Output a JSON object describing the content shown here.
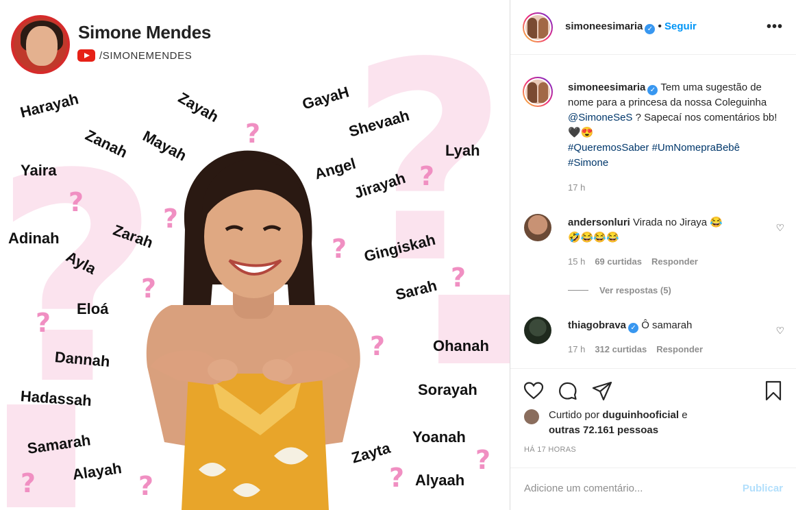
{
  "post_image": {
    "brand_title": "Simone Mendes",
    "youtube_handle": "/SIMONEMENDES",
    "names": [
      "Harayah",
      "Zayah",
      "GayaH",
      "Zanah",
      "Mayah",
      "Shevaah",
      "Yaira",
      "Lyah",
      "Angel",
      "Jirayah",
      "Zarah",
      "Adinah",
      "Ayla",
      "Gingiskah",
      "Sarah",
      "Eloá",
      "Ohanah",
      "Dannah",
      "Sorayah",
      "Hadassah",
      "Yoanah",
      "Samarah",
      "Zayta",
      "Alayah",
      "Alyaah"
    ],
    "question_mark": "?"
  },
  "header": {
    "username": "simoneesimaria",
    "verified_glyph": "✓",
    "dot": "•",
    "follow_label": "Seguir",
    "more_glyph": "•••"
  },
  "caption": {
    "username": "simoneesimaria",
    "text_before_mention": "Tem uma sugestão de nome para a princesa da nossa Coleguinha",
    "mention": "@SimoneSeS",
    "text_after_mention": "? Sapecaí nos comentários bb! 🖤😍",
    "hashtags": [
      "#QueremosSaber",
      "#UmNomepraBebê",
      "#Simone"
    ],
    "time": "17 h"
  },
  "comments": [
    {
      "username": "andersonluri",
      "text": "Virada no Jiraya 😂",
      "text_line2": "🤣😂😂😂",
      "time": "15 h",
      "likes": "69 curtidas",
      "reply": "Responder",
      "view_replies": "Ver respostas (5)"
    },
    {
      "username": "thiagobrava",
      "text": "Ô samarah",
      "time": "17 h",
      "likes": "312 curtidas",
      "reply": "Responder"
    }
  ],
  "likes": {
    "prefix": "Curtido por",
    "user": "duguinhooficial",
    "connector": "e",
    "others": "outras 72.161 pessoas"
  },
  "posted_ago": "HÁ 17 HORAS",
  "comment_box": {
    "placeholder": "Adicione um comentário...",
    "publish_label": "Publicar"
  },
  "colors": {
    "link_blue": "#0095f6",
    "hashtag": "#00376b",
    "muted": "#8e8e8e",
    "pink_qm": "#f08fc2",
    "bg_pink": "#fbe3ee"
  }
}
